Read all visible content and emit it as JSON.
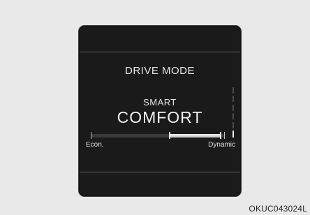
{
  "display": {
    "title": "DRIVE MODE",
    "submode": "SMART",
    "mode_value": "COMFORT",
    "gauge": {
      "left_label": "Econ.",
      "right_label": "Dynamic",
      "fill_start_fraction": 0.59,
      "fill_end_fraction": 0.97
    }
  },
  "figure_code": "OKUC043024L",
  "colors": {
    "background": "#e9e9e9",
    "panel": "#1a1a1a",
    "text": "#e6e6e6"
  }
}
